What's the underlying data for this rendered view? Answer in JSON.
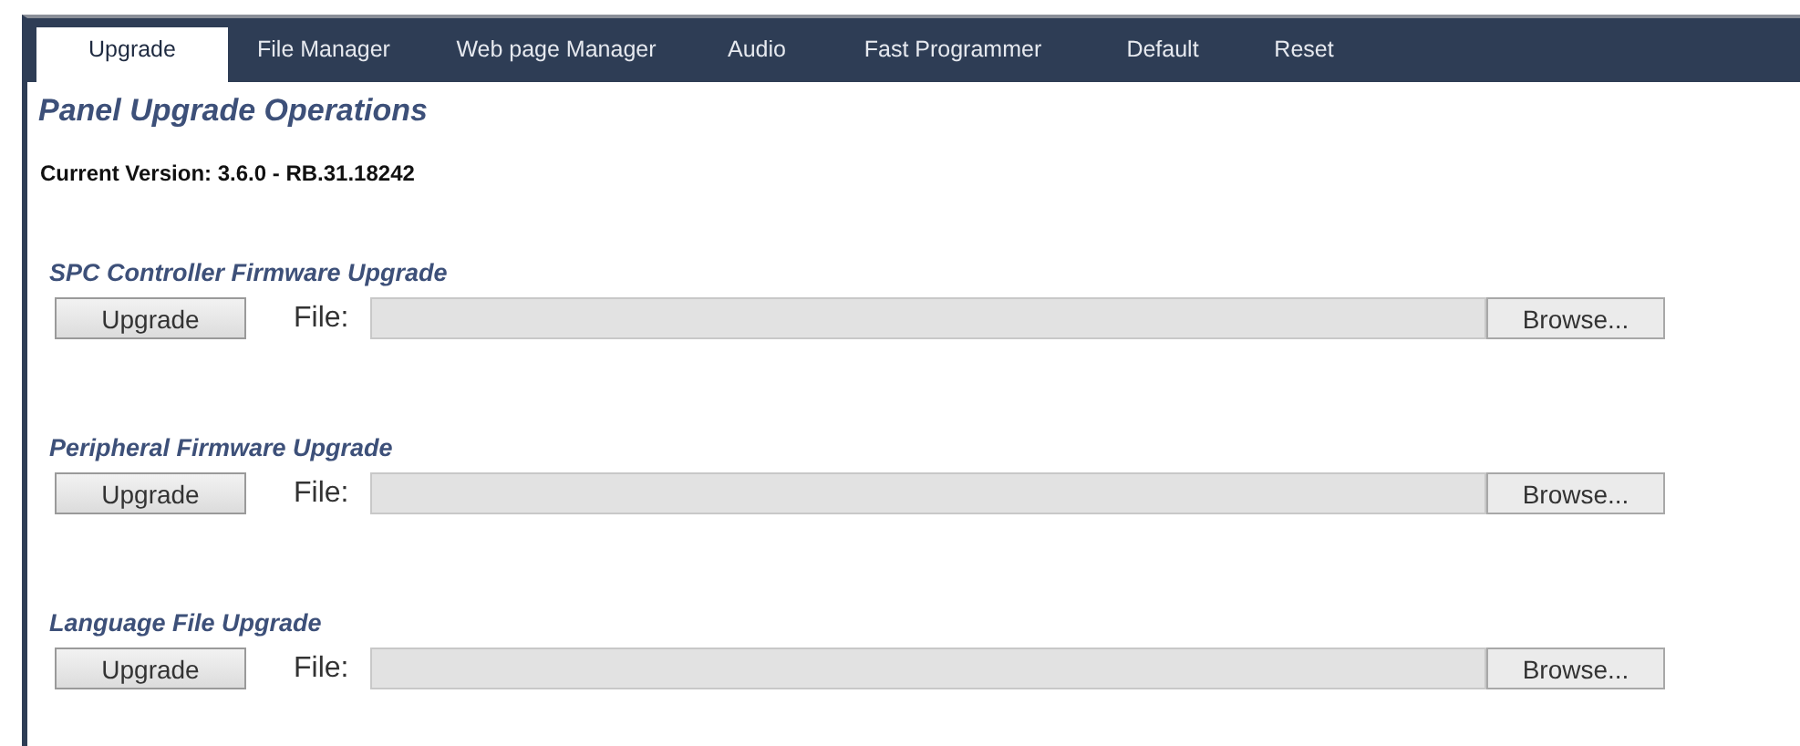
{
  "tabs": [
    {
      "label": "Upgrade",
      "selected": true
    },
    {
      "label": "File Manager",
      "selected": false
    },
    {
      "label": "Web page Manager",
      "selected": false
    },
    {
      "label": "Audio",
      "selected": false
    },
    {
      "label": "Fast Programmer",
      "selected": false
    },
    {
      "label": "Default",
      "selected": false
    },
    {
      "label": "Reset",
      "selected": false
    }
  ],
  "title": "Panel Upgrade Operations",
  "current_version": "Current Version: 3.6.0 - RB.31.18242",
  "sections": [
    {
      "heading": "SPC Controller Firmware Upgrade",
      "button": "Upgrade",
      "file_label": "File:",
      "browse": "Browse..."
    },
    {
      "heading": "Peripheral Firmware Upgrade",
      "button": "Upgrade",
      "file_label": "File:",
      "browse": "Browse..."
    },
    {
      "heading": "Language File Upgrade",
      "button": "Upgrade",
      "file_label": "File:",
      "browse": "Browse..."
    }
  ]
}
